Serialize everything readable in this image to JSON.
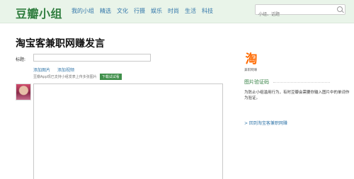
{
  "header": {
    "logo": "豆瓣小组",
    "nav": [
      "我的小组",
      "精选",
      "文化",
      "行摄",
      "娱乐",
      "时尚",
      "生活",
      "科技"
    ],
    "search_placeholder": "小组、话题"
  },
  "main": {
    "page_title": "淘宝客兼职网赚发言",
    "title_label": "标题:",
    "add_image": "添加图片",
    "add_video": "添加视频",
    "hint": "豆瓣App现已支持小组发表上传多张图片",
    "download_btn": "下载试试看"
  },
  "sidebar": {
    "group_name_caption": "兼职网赚",
    "captcha_title": "图片验证码",
    "captcha_desc": "为防止小组滥用行为，有时豆瓣会需要你输入图片中的单词作为验证。",
    "back_link": "> 回到淘宝客兼职网赚"
  },
  "colors": {
    "brand_green": "#2f7d3e",
    "link_blue": "#3377aa",
    "taobao_orange": "#ff6a00"
  }
}
